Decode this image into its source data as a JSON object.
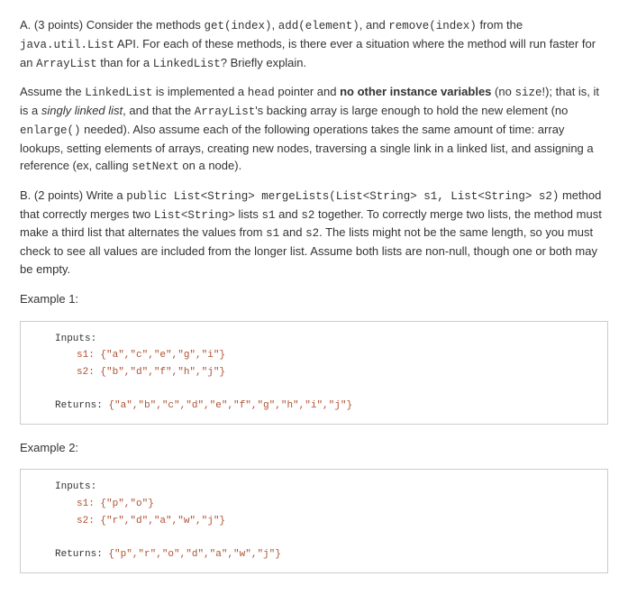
{
  "partA": {
    "para1_a": "A. (3 points) Consider the methods ",
    "m1": "get(index)",
    "sep1": ", ",
    "m2": "add(element)",
    "sep2": ", and ",
    "m3": "remove(index)",
    "para1_b": " from the ",
    "api": "java.util.List",
    "para1_c": " API. For each of these methods, is there ever a situation where the method will run faster for an ",
    "arraylist": "ArrayList",
    "para1_d": " than for a ",
    "linkedlist": "LinkedList",
    "para1_e": "? Briefly explain.",
    "para2_a": "Assume the ",
    "para2_ll": "LinkedList",
    "para2_b": " is implemented a ",
    "head": "head",
    "para2_c": " pointer and ",
    "bold1": "no other instance variables",
    "para2_d": " (no ",
    "size": "size",
    "para2_e": "!); that is, it is a ",
    "ital": "singly linked list",
    "para2_f": ", and that the ",
    "al2": "ArrayList",
    "para2_g": "'s backing array is large enough to hold the new element (no ",
    "enlarge": "enlarge()",
    "para2_h": " needed). Also assume each of the following operations takes the same amount of time: array lookups, setting elements of arrays, creating new nodes, traversing a single link in a linked list, and assigning a reference (ex, calling ",
    "setnext": "setNext",
    "para2_i": " on a node)."
  },
  "partB": {
    "para1_a": "B. (2 points) Write a ",
    "sig": "public List<String> mergeLists(List<String> s1, List<String> s2)",
    "para1_b": " method that correctly merges two ",
    "ls": "List<String>",
    "para1_c": " lists ",
    "s1": "s1",
    "and": " and ",
    "s2": "s2",
    "para1_d": " together. To correctly merge two lists, the method must make a third list that alternates the values from ",
    "s1b": "s1",
    "and2": " and ",
    "s2b": "s2",
    "para1_e": ". The lists might not be the same length, so you must check to see all values are included from the longer list. Assume both lists are non-null, though one or both may be empty."
  },
  "ex1": {
    "label": "Example 1:",
    "inputs": "Inputs:",
    "s1line": "s1: {\"a\",\"c\",\"e\",\"g\",\"i\"}",
    "s2line": "s2: {\"b\",\"d\",\"f\",\"h\",\"j\"}",
    "returns_label": "Returns: ",
    "returns_val": "{\"a\",\"b\",\"c\",\"d\",\"e\",\"f\",\"g\",\"h\",\"i\",\"j\"}"
  },
  "ex2": {
    "label": "Example 2:",
    "inputs": "Inputs:",
    "s1line": "s1: {\"p\",\"o\"}",
    "s2line": "s2: {\"r\",\"d\",\"a\",\"w\",\"j\"}",
    "returns_label": "Returns: ",
    "returns_val": "{\"p\",\"r\",\"o\",\"d\",\"a\",\"w\",\"j\"}"
  }
}
